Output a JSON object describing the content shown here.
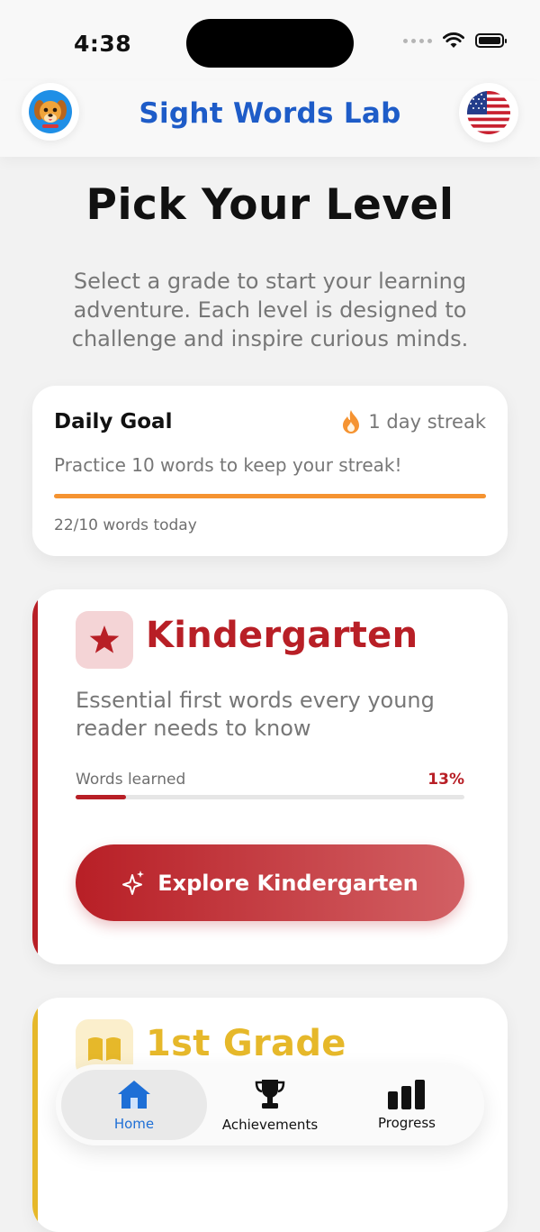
{
  "status_bar": {
    "time": "4:38"
  },
  "header": {
    "title": "Sight Words Lab",
    "avatar_icon": "puppy-avatar-icon",
    "language_icon": "us-flag-icon"
  },
  "page": {
    "title": "Pick Your Level",
    "subtitle": "Select a grade to start your learning adventure. Each level is designed to challenge and inspire curious minds."
  },
  "daily_goal": {
    "title": "Daily Goal",
    "streak": "1 day streak",
    "description": "Practice 10 words to keep your streak!",
    "count": "22/10 words today",
    "progress_fraction": 1.0,
    "color": "#f59331"
  },
  "grades": [
    {
      "name": "Kindergarten",
      "description": "Essential first words every young reader needs to know",
      "progress_label": "Words learned",
      "progress_percent": "13%",
      "progress_value": 13,
      "button_label": "Explore Kindergarten",
      "icon": "star-icon",
      "color": "#b81f26"
    },
    {
      "name": "1st Grade",
      "icon": "book-icon",
      "color": "#e6b82a"
    }
  ],
  "tabs": [
    {
      "label": "Home",
      "icon": "house-icon",
      "active": true
    },
    {
      "label": "Achievements",
      "icon": "trophy-icon",
      "active": false
    },
    {
      "label": "Progress",
      "icon": "bar-chart-icon",
      "active": false
    }
  ]
}
